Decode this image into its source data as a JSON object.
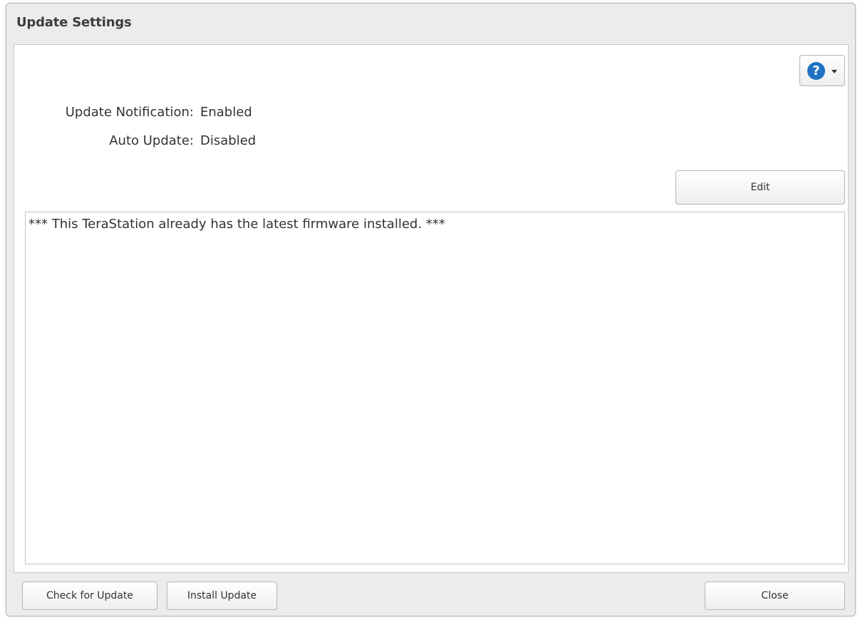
{
  "dialog": {
    "title": "Update Settings"
  },
  "help": {
    "icon": "help-icon",
    "glyph": "?",
    "accent": "#1e73c2"
  },
  "settings": {
    "update_notification": {
      "label": "Update Notification:",
      "value": "Enabled"
    },
    "auto_update": {
      "label": "Auto Update:",
      "value": "Disabled"
    }
  },
  "buttons": {
    "edit": "Edit",
    "check_for_update": "Check for Update",
    "install_update": "Install Update",
    "close": "Close"
  },
  "log": {
    "message": "*** This TeraStation already has the latest firmware installed. ***"
  }
}
